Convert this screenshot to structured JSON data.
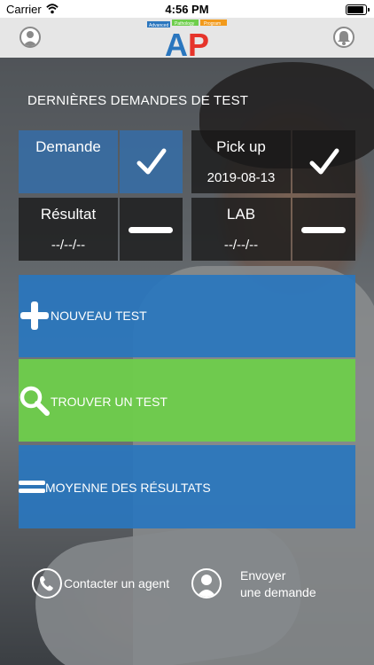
{
  "status_bar": {
    "carrier": "Carrier",
    "time": "4:56 PM"
  },
  "navbar": {
    "logo_text": "AP",
    "logo_tagline": [
      "Advanced",
      "Pathology",
      "Program"
    ],
    "colors": {
      "logo_blue": "#2a76be",
      "logo_red": "#e6342b",
      "logo_green": "#6ece4b",
      "logo_orange": "#f29a1b"
    }
  },
  "section_title": "DERNIÈRES DEMANDES DE TEST",
  "status_grid": {
    "demande": {
      "label": "Demande",
      "value": "",
      "state": "check-icon"
    },
    "pickup": {
      "label": "Pick up",
      "value": "2019-08-13",
      "state": "check-icon"
    },
    "resultat": {
      "label": "Résultat",
      "value": "--/--/--",
      "state": "dash-icon"
    },
    "lab": {
      "label": "LAB",
      "value": "--/--/--",
      "state": "dash-icon"
    }
  },
  "actions": {
    "new_test": {
      "label": "NOUVEAU TEST",
      "icon": "plus-icon"
    },
    "find_test": {
      "label": "TROUVER UN TEST",
      "icon": "magnifier-icon"
    },
    "average_results": {
      "label": "MOYENNE DES RÉSULTATS",
      "icon": "equals-icon"
    }
  },
  "bottom": {
    "contact_agent": {
      "label": "Contacter un agent",
      "icon": "phone-icon"
    },
    "send_request": {
      "label_line1": "Envoyer",
      "label_line2": "une demande",
      "icon": "person-icon"
    }
  },
  "colors": {
    "blue": "#2976be",
    "green": "#6ece4b",
    "dark_cell": "#181818"
  }
}
